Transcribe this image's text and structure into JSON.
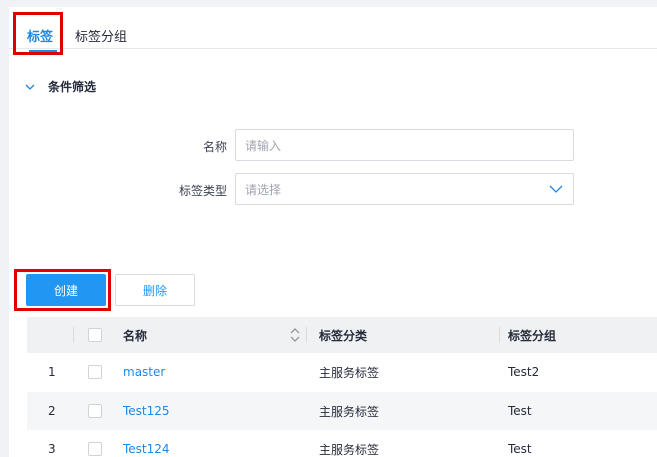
{
  "tabs": [
    {
      "label": "标签",
      "active": true
    },
    {
      "label": "标签分组",
      "active": false
    }
  ],
  "filter": {
    "title": "条件筛选",
    "name_label": "名称",
    "name_placeholder": "请输入",
    "type_label": "标签类型",
    "type_placeholder": "请选择"
  },
  "actions": {
    "create_label": "创建",
    "delete_label": "删除"
  },
  "table": {
    "columns": [
      "名称",
      "标签分类",
      "标签分组"
    ],
    "rows": [
      {
        "index": "1",
        "name": "master",
        "category": "主服务标签",
        "group": "Test2"
      },
      {
        "index": "2",
        "name": "Test125",
        "category": "主服务标签",
        "group": "Test"
      },
      {
        "index": "3",
        "name": "Test124",
        "category": "主服务标签",
        "group": "Test"
      }
    ]
  },
  "colors": {
    "accent": "#1e88e5",
    "primary_button": "#2196f3",
    "highlight_box": "#e00000"
  }
}
